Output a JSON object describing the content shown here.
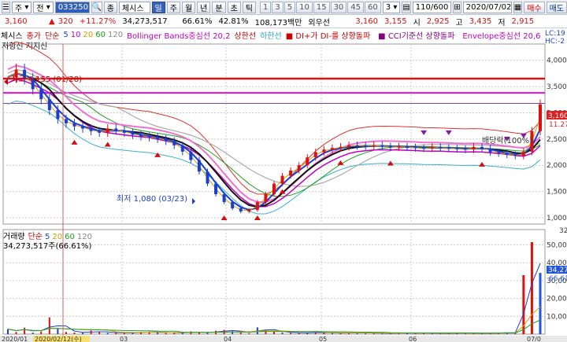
{
  "toolbar": {
    "menu_label": "주",
    "dropdown_label": "전",
    "code": "033250",
    "chart_type": "종",
    "stock_name": "체시스",
    "day_btn": "일",
    "period_buttons": [
      "주",
      "월",
      "년",
      "분",
      "초",
      "틱"
    ],
    "minute_numbers": [
      "1",
      "3",
      "5",
      "10",
      "15",
      "30",
      "45",
      "60"
    ],
    "minute_sel": "3",
    "count_text": "110/600",
    "date": "2020/07/02",
    "buy_label": "매수",
    "sell_label": "매도"
  },
  "infobar": {
    "price": "3,160",
    "change": "320",
    "rate": "+11.27%",
    "volume": "34,273,517",
    "vol_pct1": "66.61%",
    "vol_pct2": "42.81%",
    "amount": "108,173백만",
    "pref_label": "외우선",
    "open": "3,160",
    "v2": "3,155",
    "low_label": "시",
    "low_val": "2,925",
    "high_label": "고",
    "high_val": "3,435",
    "close_label": "저",
    "close_val": "2,915"
  },
  "legend": {
    "name": "체시스",
    "close": "종가",
    "ma_label": "단순",
    "ma5": "5",
    "ma10": "10",
    "ma20": "20",
    "ma60": "60",
    "ma120": "120",
    "bollinger": "Bollinger Bands중심선 20,2",
    "upper": "상한선",
    "lower": "하한선",
    "di": "DI+가 DI-를 상향돌파",
    "cci": "CCI기준선 상향돌파",
    "envelope": "Envelope중심선 20,6",
    "right_tag1": "LC:19",
    "right_tag2": "HC:-2",
    "sub_label": "저항선 지지선"
  },
  "annotations": {
    "high": "최고 4,155 (01/28)",
    "low": "최저 1,080 (03/23)",
    "dividend": "배당락(100%)"
  },
  "price_tags": {
    "current": "3,160",
    "current2": "11.27",
    "sub_tag": "32"
  },
  "volume_legend": {
    "label": "거래량",
    "ma": "단순",
    "m5": "5",
    "m20": "20",
    "m60": "60",
    "m120": "120",
    "value": "34,273,517주(66.61%)",
    "tag1": "34,27",
    "tag2": "66,61"
  },
  "x_axis": {
    "labels": [
      "2020/01",
      "2020/02/12(수)",
      "03",
      "04",
      "05",
      "06",
      "07/0"
    ]
  },
  "chart_data": [
    {
      "type": "candlestick",
      "title": "체시스",
      "y_ticks": [
        "4,000",
        "3,500",
        "3,000",
        "2,500",
        "2,000",
        "1,500",
        "1,000"
      ],
      "ylim": [
        880,
        4250
      ],
      "x_labels": [
        "2020/01",
        "03",
        "04",
        "05",
        "06",
        "07/0"
      ],
      "resistance": [
        3650,
        3380
      ],
      "support_line": 3180,
      "price_path": [
        3680,
        3820,
        3650,
        3450,
        3260,
        3050,
        2880,
        2800,
        2740,
        2700,
        2650,
        2620,
        2700,
        2660,
        2620,
        2580,
        2550,
        2530,
        2500,
        2460,
        2380,
        2260,
        2100,
        1880,
        1650,
        1450,
        1300,
        1180,
        1120,
        1150,
        1300,
        1450,
        1650,
        1800,
        1900,
        2000,
        2150,
        2250,
        2300,
        2330,
        2350,
        2380,
        2370,
        2360,
        2380,
        2360,
        2340,
        2360,
        2340,
        2330,
        2320,
        2350,
        2330,
        2320,
        2310,
        2300,
        2350,
        2320,
        2250,
        2230,
        2200,
        2180,
        2260,
        2650,
        3160
      ]
    },
    {
      "type": "bar",
      "title": "거래량",
      "y_ticks": [
        "50,000",
        "40,000",
        "30,000",
        "20,000",
        "10,000"
      ],
      "ylim": [
        0,
        55000
      ],
      "values": [
        2800,
        1200,
        3600,
        800,
        1500,
        9400,
        3100,
        1200,
        900,
        800,
        2000,
        1100,
        700,
        900,
        600,
        800,
        1200,
        1400,
        900,
        600,
        1000,
        800,
        1500,
        900,
        700,
        1900,
        2400,
        1800,
        900,
        600,
        3800,
        2500,
        1400,
        900,
        700,
        600,
        800,
        1100,
        700,
        600,
        500,
        900,
        600,
        700,
        500,
        400,
        600,
        800,
        500,
        600,
        700,
        500,
        400,
        600,
        800,
        500,
        600,
        400,
        700,
        900,
        600,
        800,
        33000,
        51500,
        34273
      ]
    }
  ]
}
